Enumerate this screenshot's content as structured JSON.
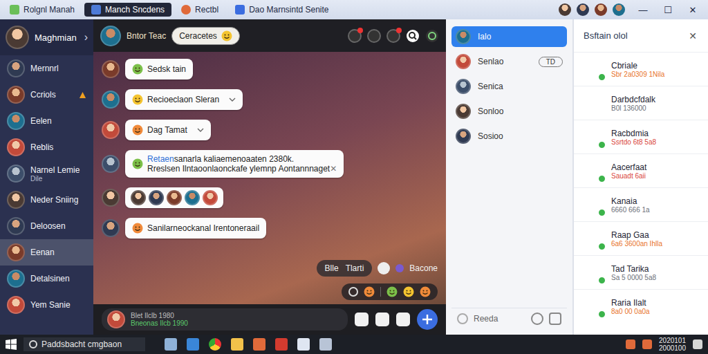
{
  "window": {
    "tabs": [
      {
        "label": "Rolgnl Manah",
        "selected": false
      },
      {
        "label": "Manch Sncdens",
        "selected": true
      },
      {
        "label": "Rectbl",
        "selected": false
      },
      {
        "label": "Dao Marnsintd Senite",
        "selected": false
      }
    ],
    "controls": [
      "—",
      "☐",
      "✕"
    ]
  },
  "sidebar": {
    "header": {
      "label": "Maghmian",
      "chevron": "›"
    },
    "items": [
      {
        "label": "Mernnrl",
        "sub": "",
        "selected": false,
        "warning": false
      },
      {
        "label": "Ccriols",
        "sub": "",
        "selected": false,
        "warning": true
      },
      {
        "label": "Eelen",
        "sub": "",
        "selected": false,
        "warning": false
      },
      {
        "label": "Reblis",
        "sub": "",
        "selected": false,
        "warning": false
      },
      {
        "label": "Narnel Lemie",
        "sub": "Dile",
        "selected": false,
        "warning": false
      },
      {
        "label": "Neder Sniing",
        "sub": "",
        "selected": false,
        "warning": false
      },
      {
        "label": "Deloosen",
        "sub": "",
        "selected": false,
        "warning": false
      },
      {
        "label": "Eenan",
        "sub": "",
        "selected": true,
        "warning": false
      },
      {
        "label": "Detalsinen",
        "sub": "",
        "selected": false,
        "warning": false
      },
      {
        "label": "Yem Sanie",
        "sub": "",
        "selected": false,
        "warning": false
      }
    ]
  },
  "chat": {
    "header": {
      "name": "Bntor Teac",
      "status": "Ceracetes"
    },
    "messages": [
      {
        "kind": "text",
        "lead": "",
        "text": "Sedsk tain",
        "text2": "",
        "chevron": false,
        "dismiss": ""
      },
      {
        "kind": "text",
        "lead": "",
        "text": "Recioeclaon Sleran",
        "text2": "",
        "chevron": true,
        "dismiss": ""
      },
      {
        "kind": "text",
        "lead": "",
        "text": "Dag Tamat",
        "text2": "",
        "chevron": true,
        "dismiss": ""
      },
      {
        "kind": "text",
        "lead": "Retaen",
        "text": "sanarla kaliaemenoaaten 2380k.",
        "text2": "Rreslsen Ilntaoonlaonckafe ylemnp Aontannnaget",
        "chevron": false,
        "dismiss": "✕"
      },
      {
        "kind": "avatars",
        "avatars": 5
      },
      {
        "kind": "text",
        "lead": "",
        "text": "Sanilarneockanal Irentoneraail",
        "text2": "",
        "chevron": false,
        "dismiss": ""
      }
    ],
    "chips": [
      "Blle",
      "Tlarti"
    ],
    "note": "Bacone",
    "composer": {
      "line1": "Blet Ilclb 1980",
      "line2": "Bneonas Ilcb 1990"
    }
  },
  "panel": {
    "items": [
      {
        "label": "Ialo",
        "selected": true,
        "tag": ""
      },
      {
        "label": "Senlao",
        "selected": false,
        "tag": "TD"
      },
      {
        "label": "Senica",
        "selected": false,
        "tag": ""
      },
      {
        "label": "Sonloo",
        "selected": false,
        "tag": ""
      },
      {
        "label": "Sosioo",
        "selected": false,
        "tag": ""
      }
    ],
    "search": {
      "placeholder": "Reeda"
    }
  },
  "contacts": {
    "title": "Bsftain olol",
    "close": "✕",
    "items": [
      {
        "name": "Cbriale",
        "sub": "Sbr 2a0309 1Nila",
        "color": "#e8732a",
        "online": true
      },
      {
        "name": "Darbdcfdalk",
        "sub": "B0l 136000",
        "color": "#6b6f78",
        "online": false
      },
      {
        "name": "Racbdmia",
        "sub": "Ssrtdo 6t8 5a8",
        "color": "#d9463c",
        "online": true
      },
      {
        "name": "Aacerfaat",
        "sub": "Sauadt 6aii",
        "color": "#d9463c",
        "online": true
      },
      {
        "name": "Kanaia",
        "sub": "6660 666 1a",
        "color": "#6b6f78",
        "online": true
      },
      {
        "name": "Raap Gaa",
        "sub": "6a6 3600an Ihlla",
        "color": "#e8732a",
        "online": true
      },
      {
        "name": "Tad Tarika",
        "sub": "Sa 5 0000 5a8",
        "color": "#6b6f78",
        "online": true
      },
      {
        "name": "Raria Ilalt",
        "sub": "8a0 00 0a0a",
        "color": "#e8732a",
        "online": true
      }
    ]
  },
  "taskbar": {
    "search": "Paddsbacht cmgbaon",
    "time": "2020101",
    "date": "2000100"
  }
}
